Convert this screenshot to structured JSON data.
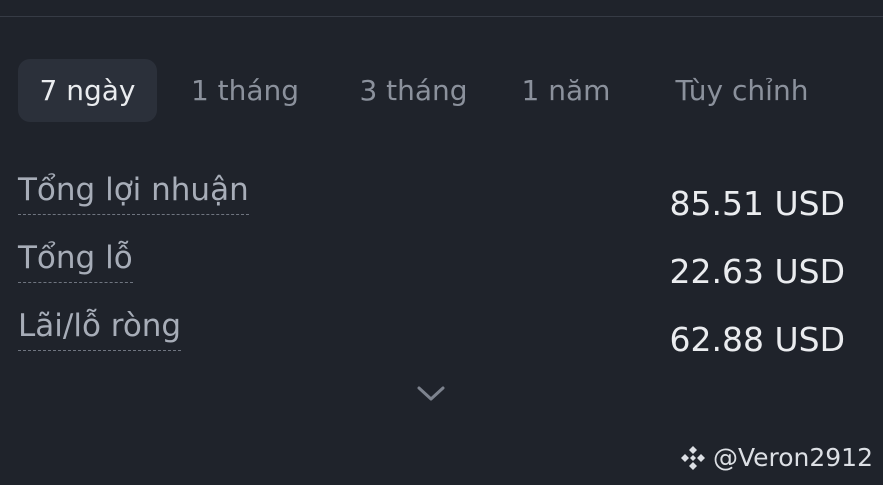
{
  "tabs": [
    {
      "label": "7 ngày",
      "active": true
    },
    {
      "label": "1 tháng",
      "active": false
    },
    {
      "label": "3 tháng",
      "active": false
    },
    {
      "label": "1 năm",
      "active": false
    },
    {
      "label": "Tùy chỉnh",
      "active": false
    }
  ],
  "stats": [
    {
      "label": "Tổng lợi nhuận",
      "value": "85.51 USD"
    },
    {
      "label": "Tổng lỗ",
      "value": "22.63 USD"
    },
    {
      "label": "Lãi/lỗ ròng",
      "value": "62.88 USD"
    }
  ],
  "expand_icon": "chevron-down-icon",
  "watermark": {
    "logo_icon": "binance-logo-icon",
    "handle": "@Veron2912"
  },
  "colors": {
    "background": "#1f232b",
    "active_tab_bg": "#2b303a",
    "text_primary": "#eaecef",
    "text_secondary": "#8b919c"
  }
}
